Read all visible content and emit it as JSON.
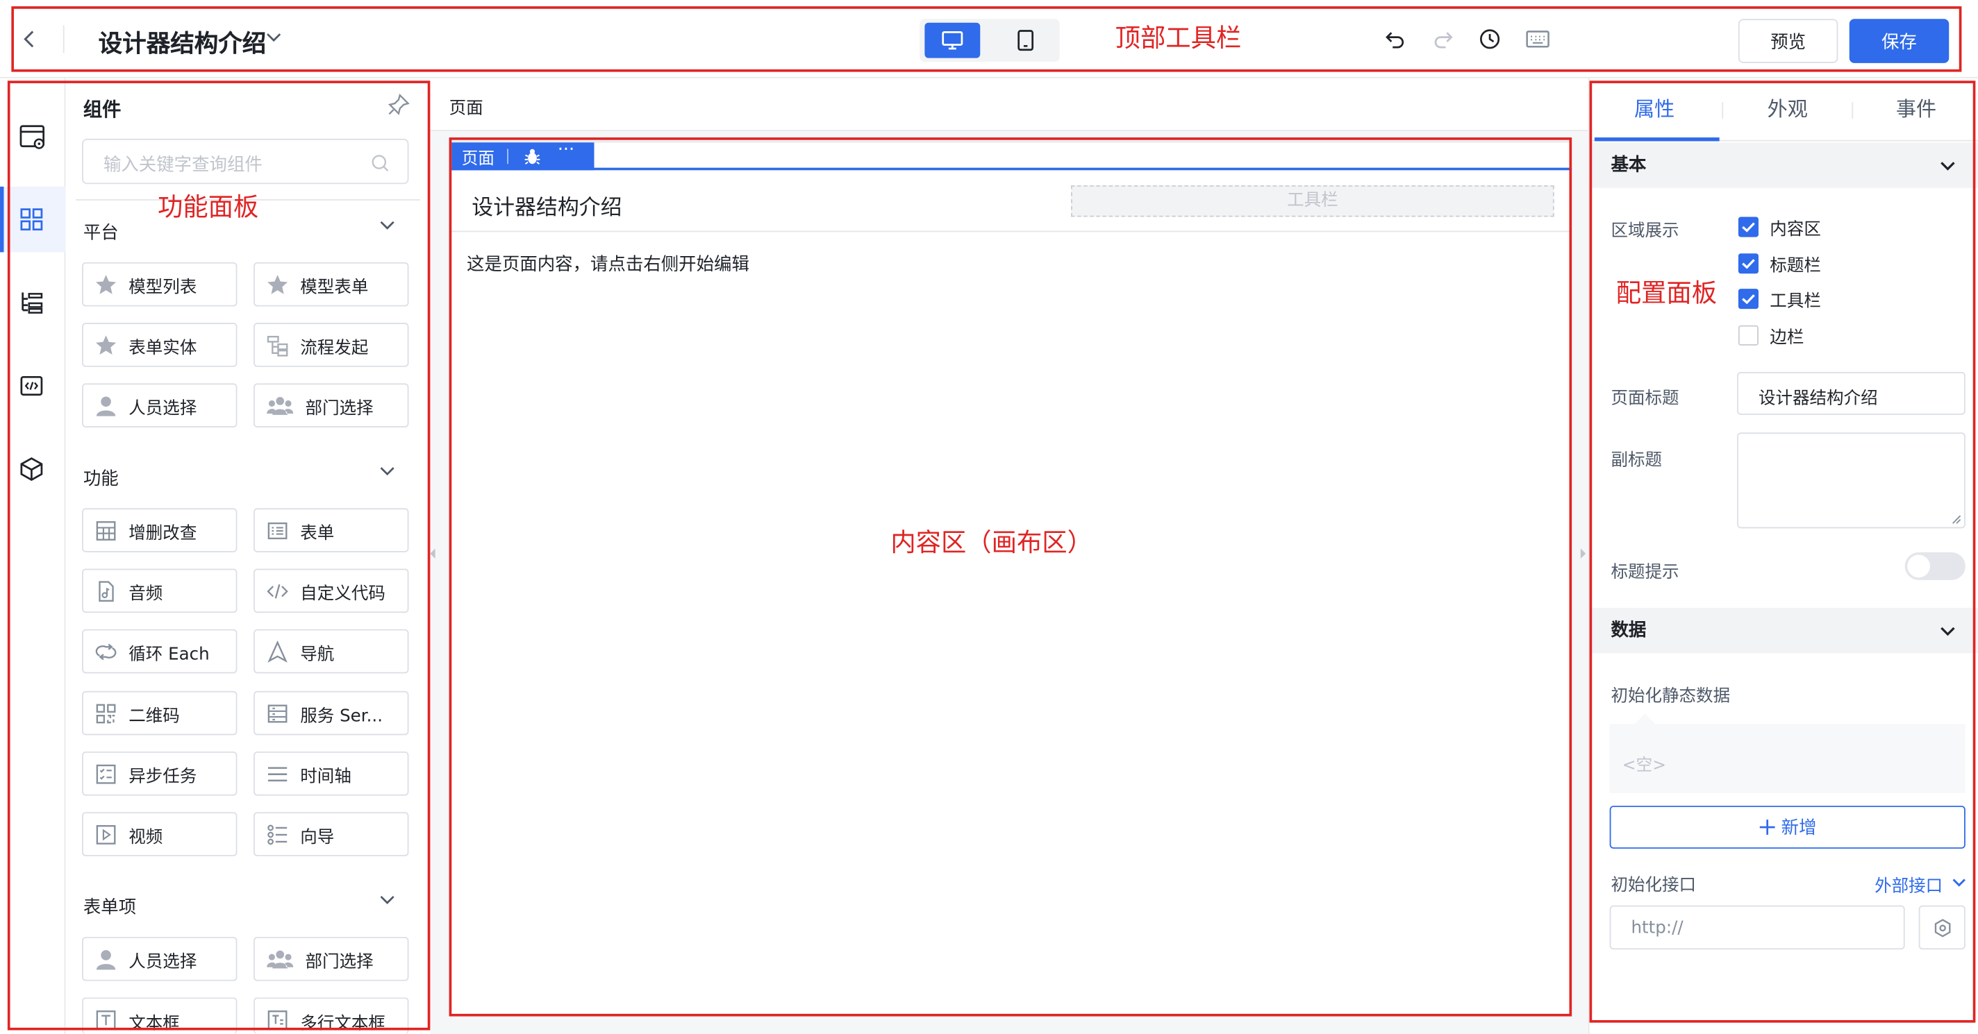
{
  "annotations": {
    "top_toolbar": "顶部工具栏",
    "function_panel": "功能面板",
    "content_area": "内容区（画布区）",
    "config_panel": "配置面板"
  },
  "header": {
    "title": "设计器结构介绍",
    "preview": "预览",
    "save": "保存"
  },
  "panel": {
    "title": "组件",
    "search_placeholder": "输入关键字查询组件",
    "sections": [
      {
        "name": "平台",
        "items": [
          "模型列表",
          "模型表单",
          "表单实体",
          "流程发起",
          "人员选择",
          "部门选择"
        ]
      },
      {
        "name": "功能",
        "items": [
          "增删改查",
          "表单",
          "音频",
          "自定义代码",
          "循环 Each",
          "导航",
          "二维码",
          "服务 Ser...",
          "异步任务",
          "时间轴",
          "视频",
          "向导"
        ]
      },
      {
        "name": "表单项",
        "items": [
          "人员选择",
          "部门选择",
          "文本框",
          "多行文本框"
        ]
      }
    ]
  },
  "canvas": {
    "breadcrumb": "页面",
    "tag_label": "页面",
    "page_title": "设计器结构介绍",
    "toolbar_placeholder": "工具栏",
    "content_text": "这是页面内容，请点击右侧开始编辑"
  },
  "config": {
    "tabs": [
      "属性",
      "外观",
      "事件"
    ],
    "active_tab": "属性",
    "basic": {
      "header": "基本",
      "area_label": "区域展示",
      "checks": [
        {
          "label": "内容区",
          "checked": true
        },
        {
          "label": "标题栏",
          "checked": true
        },
        {
          "label": "工具栏",
          "checked": true
        },
        {
          "label": "边栏",
          "checked": false
        }
      ],
      "title_label": "页面标题",
      "title_value": "设计器结构介绍",
      "subtitle_label": "副标题",
      "tip_label": "标题提示"
    },
    "data": {
      "header": "数据",
      "init_label": "初始化静态数据",
      "empty": "<空>",
      "add_btn": "新增",
      "api_label": "初始化接口",
      "api_type": "外部接口",
      "api_placeholder": "http://"
    }
  },
  "colors": {
    "accent": "#2f6bea",
    "annotation": "#e02424"
  }
}
